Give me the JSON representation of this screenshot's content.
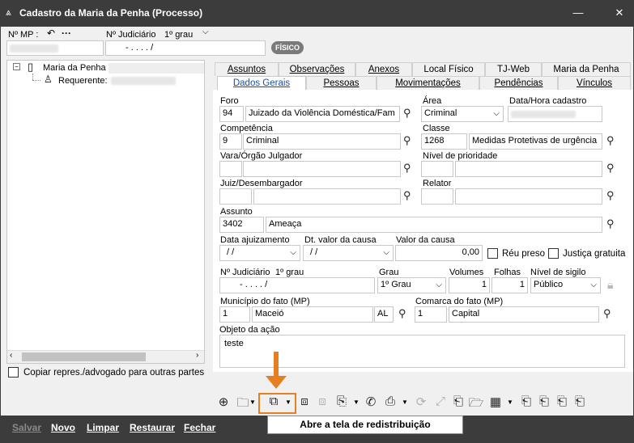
{
  "window": {
    "title": "Cadastro da Maria da Penha (Processo)"
  },
  "header": {
    "nmp_label": "Nº MP :",
    "nmp_back": "↶",
    "nmp_more": "···",
    "judicial_label": "Nº Judiciário",
    "judicial_grau": "1º grau",
    "judicial_value": "-  .   . . .   /",
    "fisico_badge": "FÍSICO"
  },
  "tree": {
    "root": "Maria da Penha",
    "child": "Requerente:",
    "copy_label": "Copiar repres./advogado para outras partes"
  },
  "tabs_row1": [
    "Assuntos",
    "Observações",
    "Anexos",
    "Local Físico",
    "TJ-Web",
    "Maria da Penha"
  ],
  "tabs_row2": [
    "Dados Gerais",
    "Pessoas",
    "Movimentações",
    "Pendências",
    "Vínculos"
  ],
  "form": {
    "foro_label": "Foro",
    "foro_code": "94",
    "foro_name": "Juizado da Violência Doméstica/Fam",
    "area_label": "Área",
    "area_value": "Criminal",
    "data_cadastro_label": "Data/Hora cadastro",
    "competencia_label": "Competência",
    "competencia_code": "9",
    "competencia_name": "Criminal",
    "classe_label": "Classe",
    "classe_code": "1268",
    "classe_name": "Medidas Protetivas de urgência",
    "vara_label": "Vara/Órgão Julgador",
    "nivel_prioridade_label": "Nível de prioridade",
    "juiz_label": "Juiz/Desembargador",
    "relator_label": "Relator",
    "assunto_label": "Assunto",
    "assunto_code": "3402",
    "assunto_name": "Ameaça",
    "data_ajuizamento_label": "Data ajuizamento",
    "data_ajuizamento_value": "/ /",
    "dt_valor_label": "Dt. valor da causa",
    "dt_valor_value": "/ /",
    "valor_causa_label": "Valor da causa",
    "valor_causa_value": "0,00",
    "reu_preso_label": "Réu preso",
    "justica_gratuita_label": "Justiça gratuita",
    "nj_label": "Nº Judiciário",
    "nj_grau_label": "1º grau",
    "nj_value": "-  .   . . .   /",
    "grau_label": "Grau",
    "grau_value": "1º Grau",
    "volumes_label": "Volumes",
    "volumes_value": "1",
    "folhas_label": "Folhas",
    "folhas_value": "1",
    "sigilo_label": "Nível de sigilo",
    "sigilo_value": "Público",
    "municipio_label": "Município do fato (MP)",
    "municipio_code": "1",
    "municipio_name": "Maceió",
    "municipio_uf": "AL",
    "comarca_label": "Comarca do fato (MP)",
    "comarca_code": "1",
    "comarca_name": "Capital",
    "objeto_label": "Objeto da ação",
    "objeto_value": "teste"
  },
  "tooltip": {
    "redistribuicao": "Abre a tela de redistribuição"
  },
  "bottom": {
    "salvar": "Salvar",
    "novo": "Novo",
    "limpar": "Limpar",
    "restaurar": "Restaurar",
    "fechar": "Fechar"
  },
  "colors": {
    "accent": "#e67e22",
    "titlebar": "#3c3c3c",
    "active_tab_text": "#1a4fa0"
  }
}
